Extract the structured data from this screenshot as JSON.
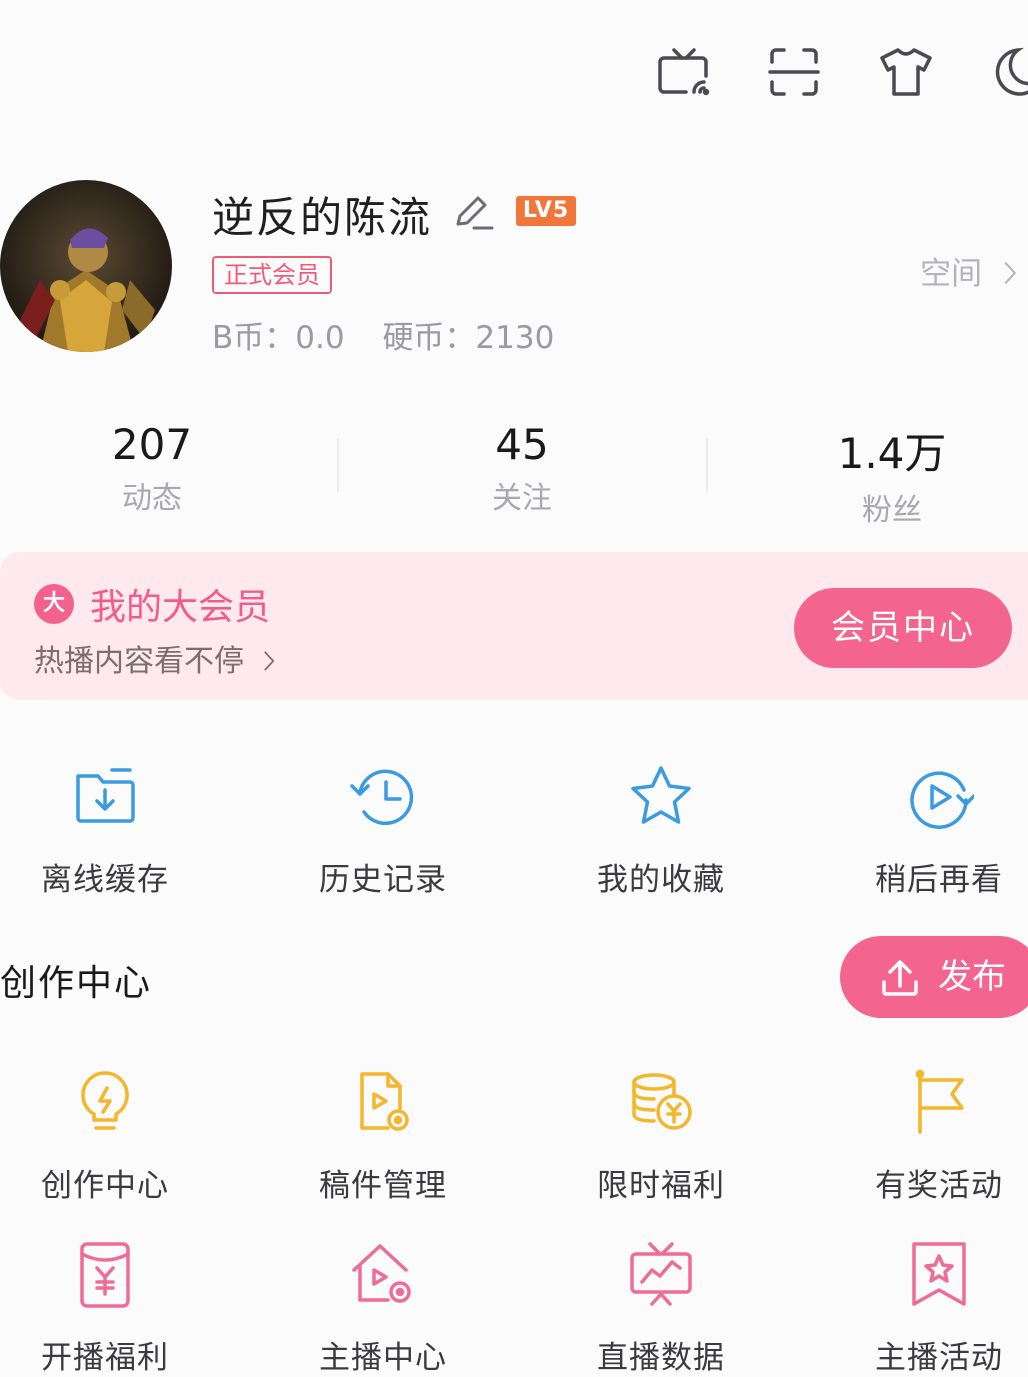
{
  "header": {
    "icons": [
      "tv-cast-icon",
      "scan-icon",
      "tshirt-icon",
      "moon-icon"
    ]
  },
  "profile": {
    "username": "逆反的陈流",
    "level": "LV5",
    "member_tag": "正式会员",
    "b_coin": "B币：0.0",
    "hard_coin": "硬币：2130",
    "space_link": "空间"
  },
  "stats": [
    {
      "value": "207",
      "label": "动态"
    },
    {
      "value": "45",
      "label": "关注"
    },
    {
      "value": "1.4万",
      "label": "粉丝"
    }
  ],
  "vip": {
    "badge": "大",
    "title": "我的大会员",
    "subtitle": "热播内容看不停",
    "button": "会员中心"
  },
  "quick_actions": [
    {
      "label": "离线缓存",
      "icon": "offline-cache-icon"
    },
    {
      "label": "历史记录",
      "icon": "history-icon"
    },
    {
      "label": "我的收藏",
      "icon": "star-icon"
    },
    {
      "label": "稍后再看",
      "icon": "watch-later-icon"
    }
  ],
  "creation": {
    "title": "创作中心",
    "publish_button": "发布",
    "items": [
      {
        "label": "创作中心",
        "icon": "lightbulb-icon"
      },
      {
        "label": "稿件管理",
        "icon": "manuscript-icon"
      },
      {
        "label": "限时福利",
        "icon": "coins-icon"
      },
      {
        "label": "有奖活动",
        "icon": "flag-icon"
      },
      {
        "label": "开播福利",
        "icon": "red-packet-icon"
      },
      {
        "label": "主播中心",
        "icon": "streamer-home-icon"
      },
      {
        "label": "直播数据",
        "icon": "live-data-icon"
      },
      {
        "label": "主播活动",
        "icon": "bookmark-star-icon"
      }
    ]
  },
  "colors": {
    "accent_pink": "#f3658f",
    "blue_icon": "#3a9be0",
    "yellow_icon": "#f4b62a",
    "pink_icon": "#ef6c96",
    "vip_bg": "#fde9ee"
  }
}
